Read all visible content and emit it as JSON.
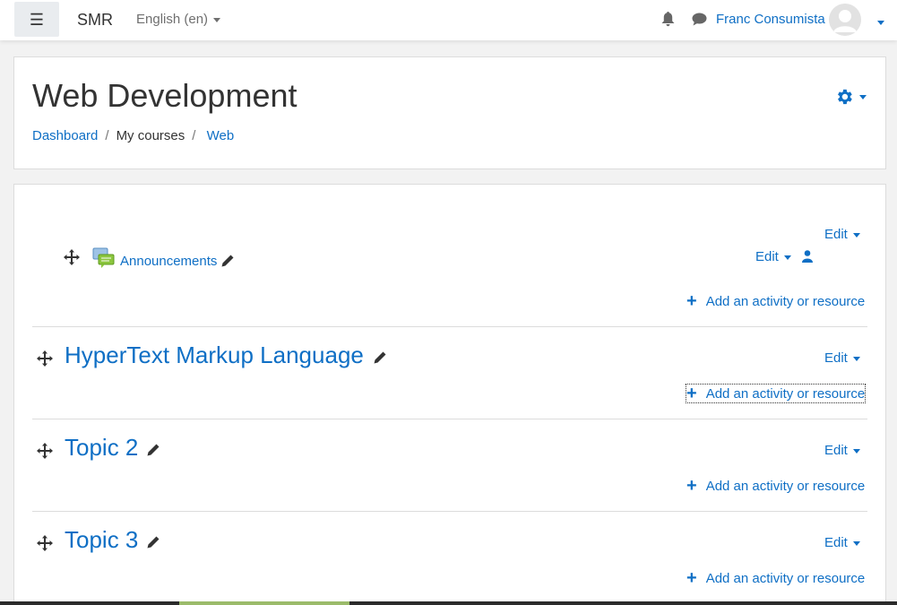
{
  "navbar": {
    "brand": "SMR",
    "language": "English (en)",
    "user_name": "Franc Consumista"
  },
  "header": {
    "title": "Web Development",
    "breadcrumb": [
      "Dashboard",
      "My courses",
      "Web"
    ]
  },
  "course": {
    "general_section": {
      "edit_label": "Edit",
      "activity": {
        "name": "Announcements",
        "edit_label": "Edit"
      },
      "add_label": "Add an activity or resource"
    },
    "sections": [
      {
        "title": "HyperText Markup Language",
        "edit_label": "Edit",
        "add_label": "Add an activity or resource"
      },
      {
        "title": "Topic 2",
        "edit_label": "Edit",
        "add_label": "Add an activity or resource"
      },
      {
        "title": "Topic 3",
        "edit_label": "Edit",
        "add_label": "Add an activity or resource"
      }
    ]
  },
  "colors": {
    "link": "#0f6fc5",
    "text": "#333333",
    "page_bg": "#f2f2f2"
  }
}
